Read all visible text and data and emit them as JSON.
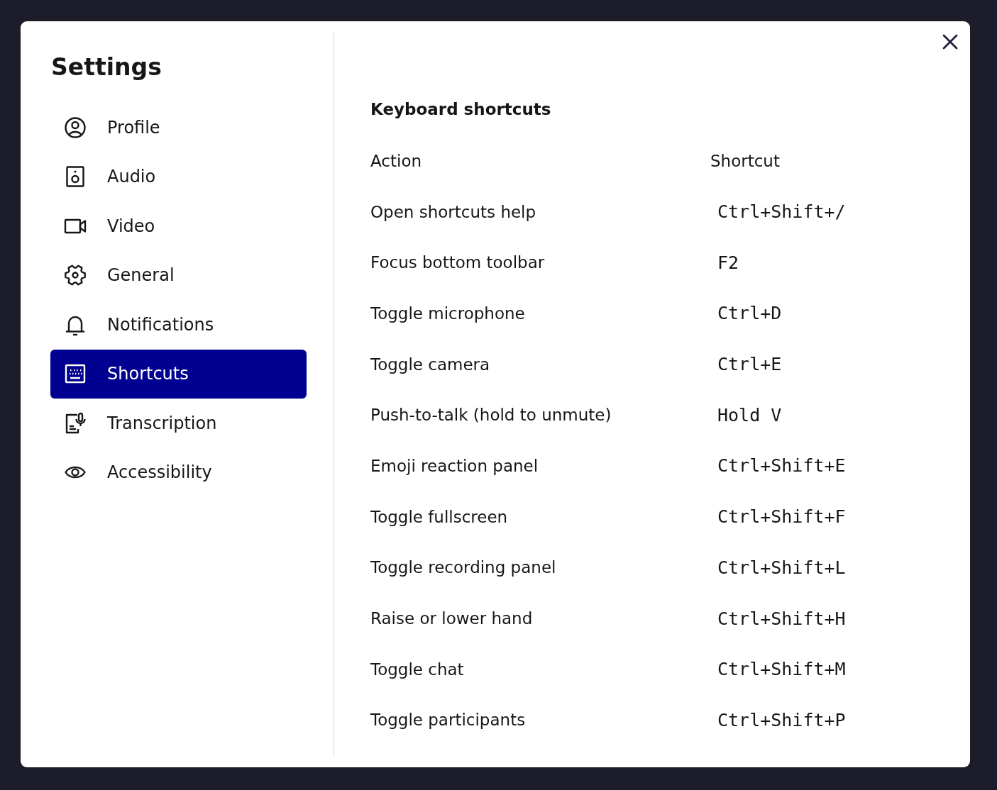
{
  "dialog": {
    "title": "Settings"
  },
  "sidebar": {
    "items": [
      {
        "label": "Profile",
        "selected": false
      },
      {
        "label": "Audio",
        "selected": false
      },
      {
        "label": "Video",
        "selected": false
      },
      {
        "label": "General",
        "selected": false
      },
      {
        "label": "Notifications",
        "selected": false
      },
      {
        "label": "Shortcuts",
        "selected": true
      },
      {
        "label": "Transcription",
        "selected": false
      },
      {
        "label": "Accessibility",
        "selected": false
      }
    ]
  },
  "content": {
    "title": "Keyboard shortcuts",
    "table": {
      "columns": [
        "Action",
        "Shortcut"
      ],
      "rows": [
        {
          "action": "Open shortcuts help",
          "shortcut": "Ctrl+Shift+/"
        },
        {
          "action": "Focus bottom toolbar",
          "shortcut": "F2"
        },
        {
          "action": "Toggle microphone",
          "shortcut": "Ctrl+D"
        },
        {
          "action": "Toggle camera",
          "shortcut": "Ctrl+E"
        },
        {
          "action": "Push-to-talk (hold to unmute)",
          "shortcut": "Hold V"
        },
        {
          "action": "Emoji reaction panel",
          "shortcut": "Ctrl+Shift+E"
        },
        {
          "action": "Toggle fullscreen",
          "shortcut": "Ctrl+Shift+F"
        },
        {
          "action": "Toggle recording panel",
          "shortcut": "Ctrl+Shift+L"
        },
        {
          "action": "Raise or lower hand",
          "shortcut": "Ctrl+Shift+H"
        },
        {
          "action": "Toggle chat",
          "shortcut": "Ctrl+Shift+M"
        },
        {
          "action": "Toggle participants",
          "shortcut": "Ctrl+Shift+P"
        }
      ]
    }
  }
}
